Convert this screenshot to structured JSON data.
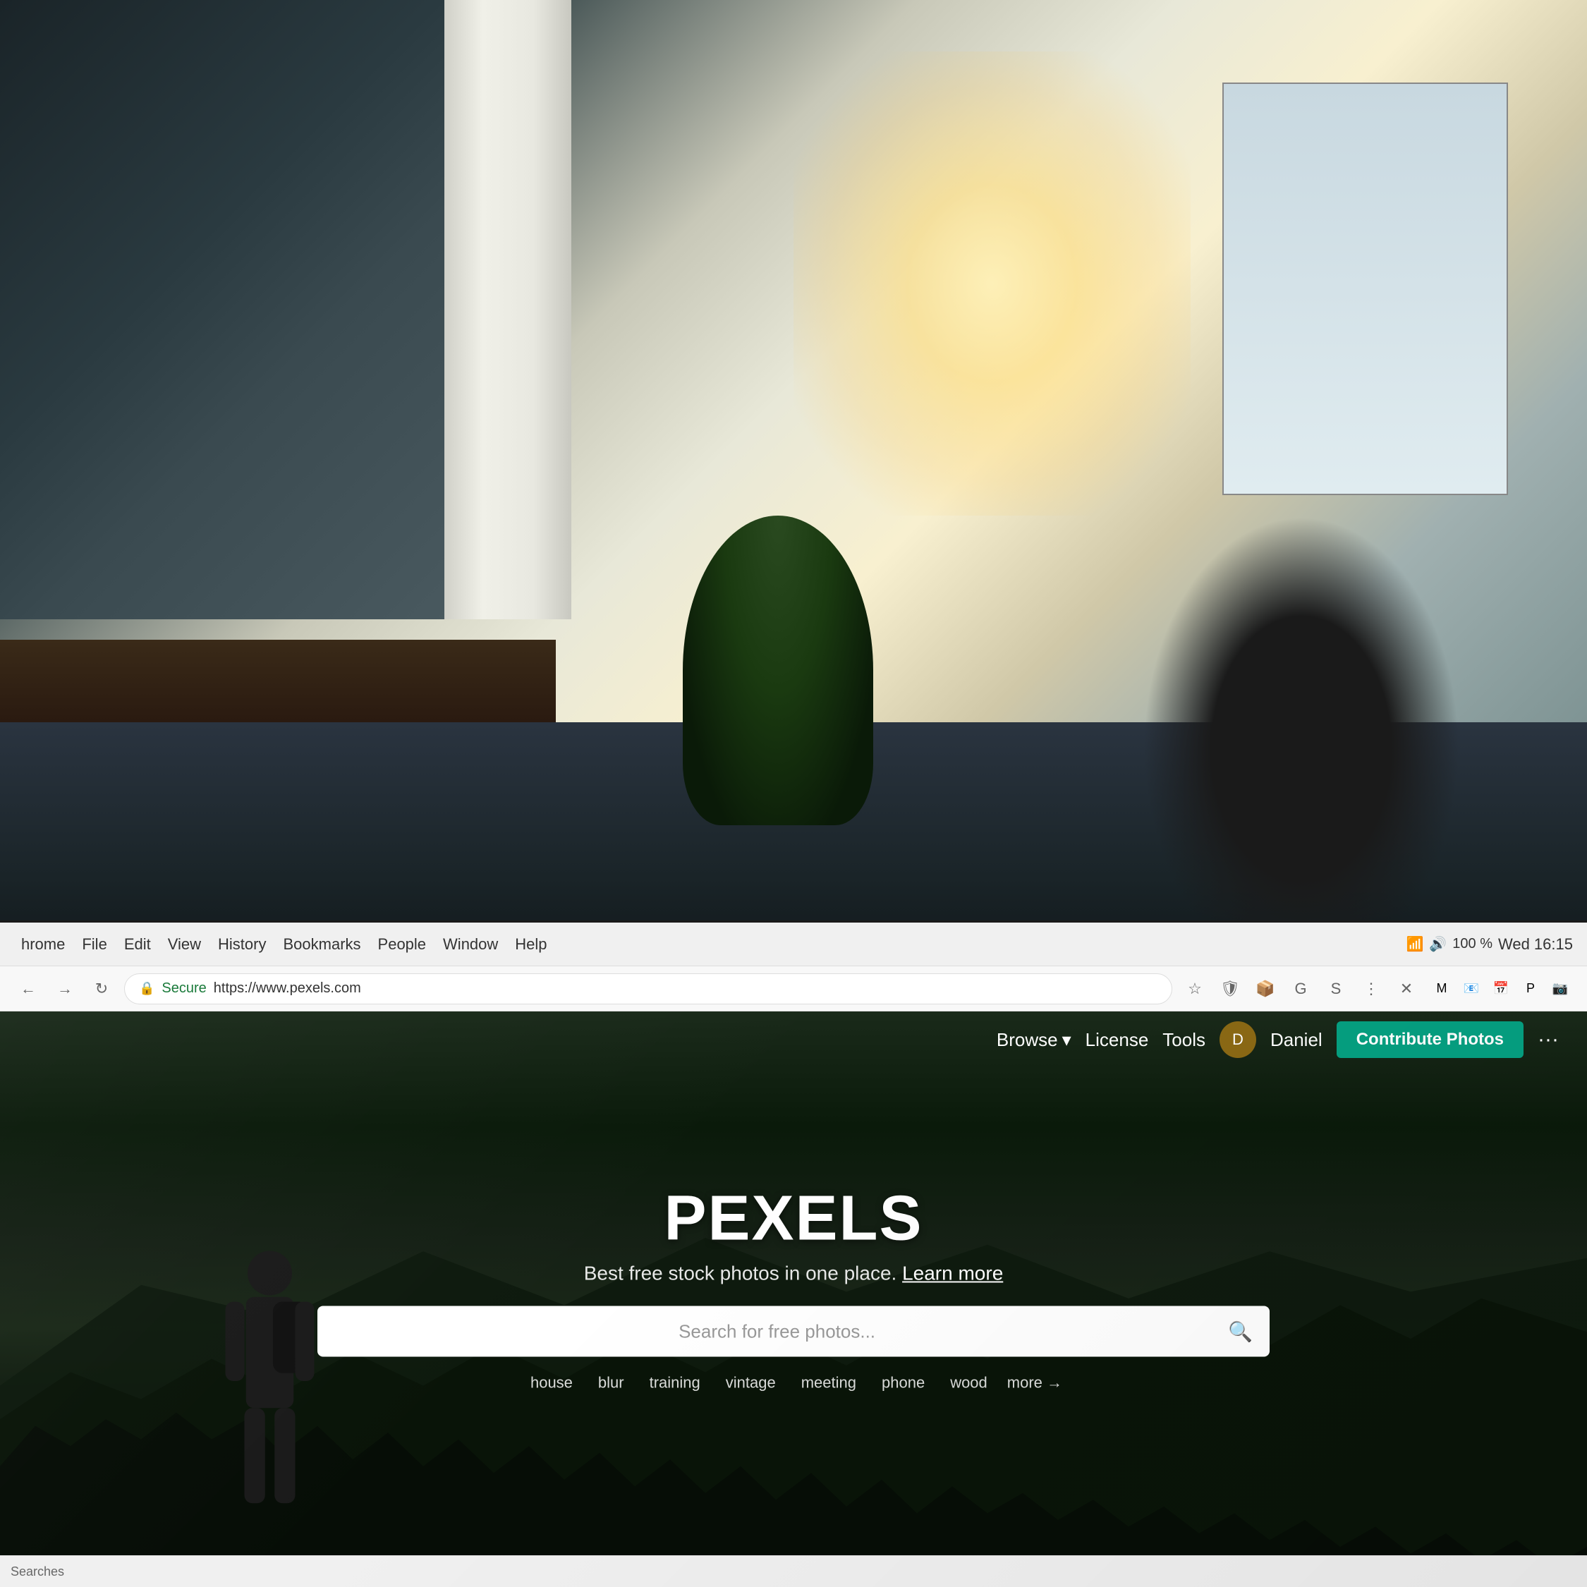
{
  "background": {
    "description": "Office scene with blurred background"
  },
  "chrome": {
    "menu_items": [
      "hrome",
      "File",
      "Edit",
      "View",
      "History",
      "Bookmarks",
      "People",
      "Window",
      "Help"
    ],
    "system_time": "Wed 16:15",
    "battery": "100 %",
    "url_secure": "Secure",
    "url": "https://www.pexels.com",
    "bottom_status": "Searches"
  },
  "pexels": {
    "logo": "PEXELS",
    "tagline": "Best free stock photos in one place.",
    "tagline_link": "Learn more",
    "search_placeholder": "Search for free photos...",
    "nav": {
      "browse": "Browse",
      "license": "License",
      "tools": "Tools",
      "username": "Daniel",
      "contribute": "Contribute Photos",
      "more": "···"
    },
    "suggestions": [
      "house",
      "blur",
      "training",
      "vintage",
      "meeting",
      "phone",
      "wood",
      "more →"
    ]
  }
}
